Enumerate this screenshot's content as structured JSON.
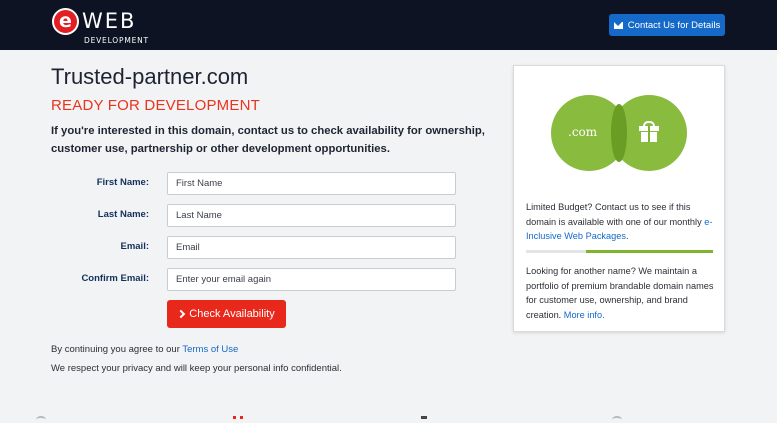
{
  "header": {
    "logo_mark": "e",
    "logo_word": "WEB",
    "logo_sub": "DEVELOPMENT",
    "contact_label": "Contact Us for Details"
  },
  "main": {
    "domain": "Trusted-partner.com",
    "headline": "READY FOR DEVELOPMENT",
    "intro": "If you're interested in this domain, contact us to check availability for ownership, customer use, partnership or other development opportunities."
  },
  "form": {
    "first_name_label": "First Name:",
    "first_name_placeholder": "First Name",
    "last_name_label": "Last Name:",
    "last_name_placeholder": "Last Name",
    "email_label": "Email:",
    "email_placeholder": "Email",
    "confirm_email_label": "Confirm Email:",
    "confirm_email_placeholder": "Enter your email again",
    "submit_label": "Check Availability"
  },
  "footer": {
    "terms_prefix": "By continuing you agree to our ",
    "terms_link": "Terms of Use",
    "privacy": "We respect your privacy and will keep your personal info confidential."
  },
  "sidebar": {
    "com_text": ".com",
    "budget_text": "Limited Budget? Contact us to see if this domain is available with one of our monthly ",
    "budget_link": "e-Inclusive Web Packages",
    "budget_suffix": ".",
    "another_text": "Looking for another name? We maintain a portfolio of premium brandable domain names for customer use, ownership, and brand creation. ",
    "another_link": "More info.",
    "accent_color": "#7fb52e"
  },
  "colors": {
    "header_bg": "#0d1322",
    "primary_blue": "#1469c9",
    "cta_red": "#e9281c",
    "headline_orange": "#e8351f"
  }
}
